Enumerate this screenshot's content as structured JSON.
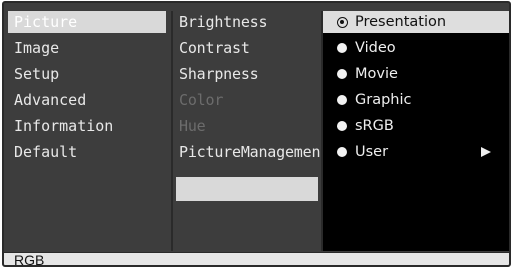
{
  "menu": {
    "main_items": [
      {
        "label": "Picture",
        "selected": true
      },
      {
        "label": "Image"
      },
      {
        "label": "Setup"
      },
      {
        "label": "Advanced"
      },
      {
        "label": "Information"
      },
      {
        "label": "Default"
      }
    ],
    "sub_items": [
      {
        "label": "Brightness",
        "enabled": true
      },
      {
        "label": "Contrast",
        "enabled": true
      },
      {
        "label": "Sharpness",
        "enabled": true
      },
      {
        "label": "Color",
        "enabled": false
      },
      {
        "label": "Hue",
        "enabled": false
      },
      {
        "label": "PictureManagement",
        "enabled": true
      }
    ],
    "options": [
      {
        "label": "Presentation",
        "selected": true
      },
      {
        "label": "Video"
      },
      {
        "label": "Movie"
      },
      {
        "label": "Graphic"
      },
      {
        "label": "sRGB"
      },
      {
        "label": "User",
        "has_submenu": true
      }
    ]
  },
  "status": {
    "source": "RGB"
  },
  "colors": {
    "panel_bg": "#3d3d3d",
    "highlight": "#d9d9d9",
    "options_bg": "#000000",
    "disabled_text": "#6c6c6c"
  }
}
